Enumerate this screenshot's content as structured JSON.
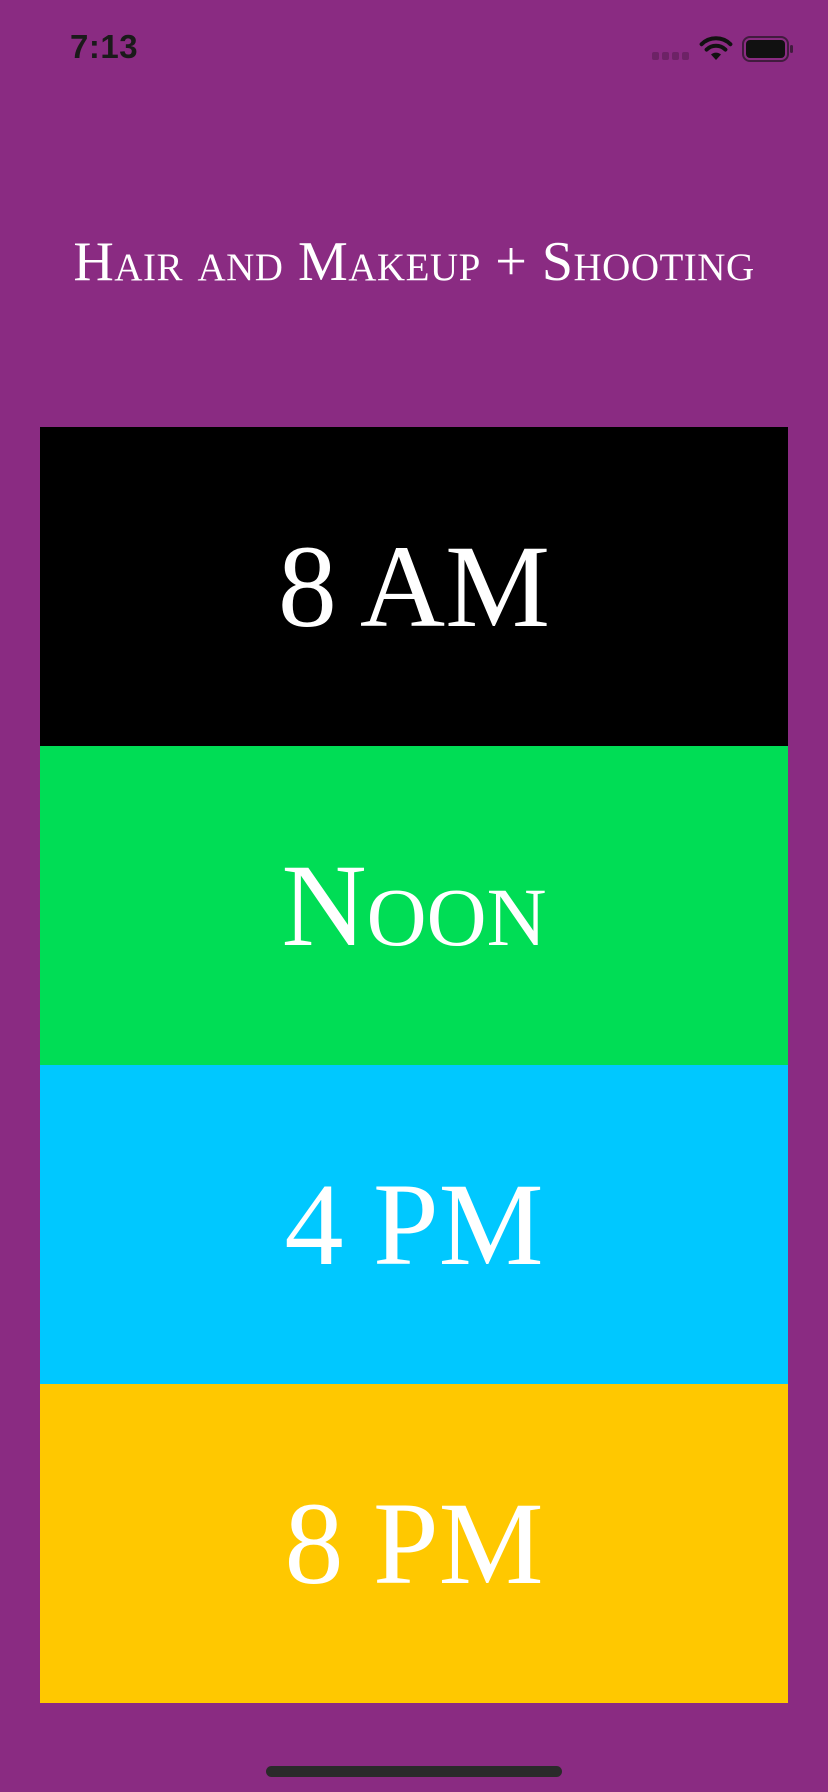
{
  "status_bar": {
    "time": "7:13",
    "icons": [
      "cellular-signal-icon",
      "wifi-icon",
      "battery-icon"
    ]
  },
  "screen": {
    "title": "Hair and Makeup + Shooting",
    "background_color": "#8a2b82"
  },
  "time_slots": [
    {
      "label": "8 AM",
      "color": "#000000"
    },
    {
      "label": "Noon",
      "color": "#00dd55"
    },
    {
      "label": "4 PM",
      "color": "#00c8ff"
    },
    {
      "label": "8 PM",
      "color": "#ffc800"
    }
  ]
}
